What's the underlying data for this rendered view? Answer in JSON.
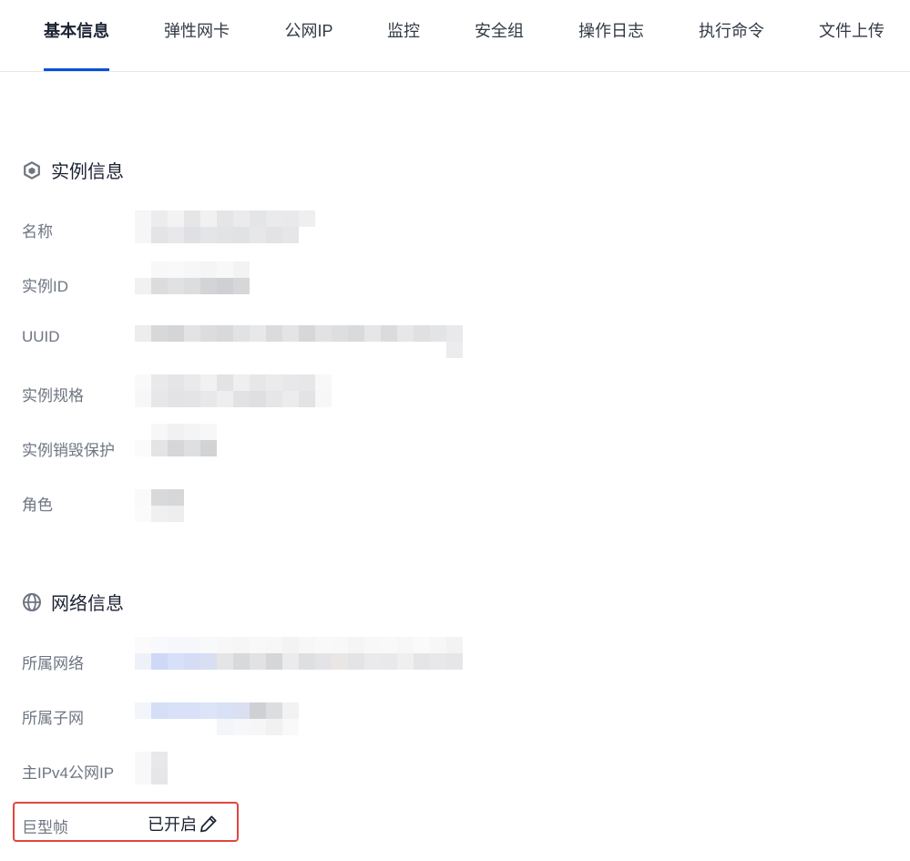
{
  "tabs": [
    {
      "label": "基本信息",
      "active": true
    },
    {
      "label": "弹性网卡",
      "active": false
    },
    {
      "label": "公网IP",
      "active": false
    },
    {
      "label": "监控",
      "active": false
    },
    {
      "label": "安全组",
      "active": false
    },
    {
      "label": "操作日志",
      "active": false
    },
    {
      "label": "执行命令",
      "active": false
    },
    {
      "label": "文件上传",
      "active": false
    }
  ],
  "instance_section": {
    "title": "实例信息",
    "icon": "cube-icon",
    "rows": [
      {
        "label": "名称",
        "value_redacted": true
      },
      {
        "label": "实例ID",
        "value_redacted": true
      },
      {
        "label": "UUID",
        "value_redacted": true
      },
      {
        "label": "实例规格",
        "value_redacted": true
      },
      {
        "label": "实例销毁保护",
        "value_redacted": true
      },
      {
        "label": "角色",
        "value_redacted": true
      }
    ]
  },
  "network_section": {
    "title": "网络信息",
    "icon": "globe-icon",
    "rows": [
      {
        "label": "所属网络",
        "value_redacted": true
      },
      {
        "label": "所属子网",
        "value_redacted": true
      },
      {
        "label": "主IPv4公网IP",
        "value_redacted": true
      }
    ],
    "jumbo_frame": {
      "label": "巨型帧",
      "value": "已开启",
      "edit_icon": "pencil-icon"
    }
  },
  "colors": {
    "accent": "#0052d9",
    "highlight_border": "#e1463f"
  }
}
